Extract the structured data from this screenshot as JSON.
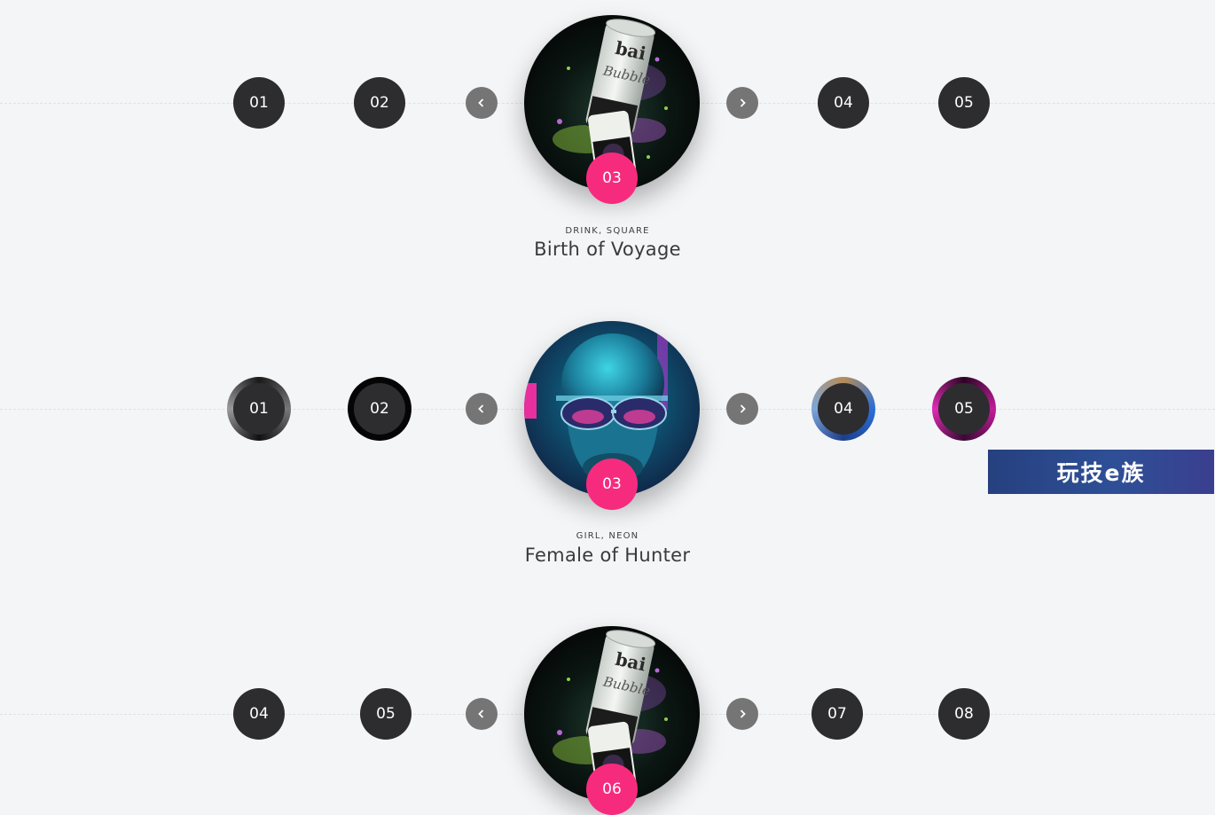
{
  "sliders": [
    {
      "dots_left": [
        "01",
        "02"
      ],
      "dots_right": [
        "04",
        "05"
      ],
      "active": "03",
      "category": "DRINK, SQUARE",
      "title": "Birth of Voyage",
      "image": "bai bubbles can splash image"
    },
    {
      "dots_left": [
        "01",
        "02"
      ],
      "dots_right": [
        "04",
        "05"
      ],
      "active": "03",
      "category": "GIRL, NEON",
      "title": "Female of Hunter",
      "image": "neon girl with sunglasses image"
    },
    {
      "dots_left": [
        "04",
        "05"
      ],
      "dots_right": [
        "07",
        "08"
      ],
      "active": "06",
      "image": "bai bubbles can splash image"
    }
  ],
  "icons": {
    "prev": "chevron-left-icon",
    "next": "chevron-right-icon"
  },
  "watermark": "玩技e族",
  "colors": {
    "background": "#f4f5f7",
    "dot": "#2d2d2f",
    "arrow": "#757575",
    "active_badge": "#f72b7e",
    "text": "#3a3a3a"
  }
}
